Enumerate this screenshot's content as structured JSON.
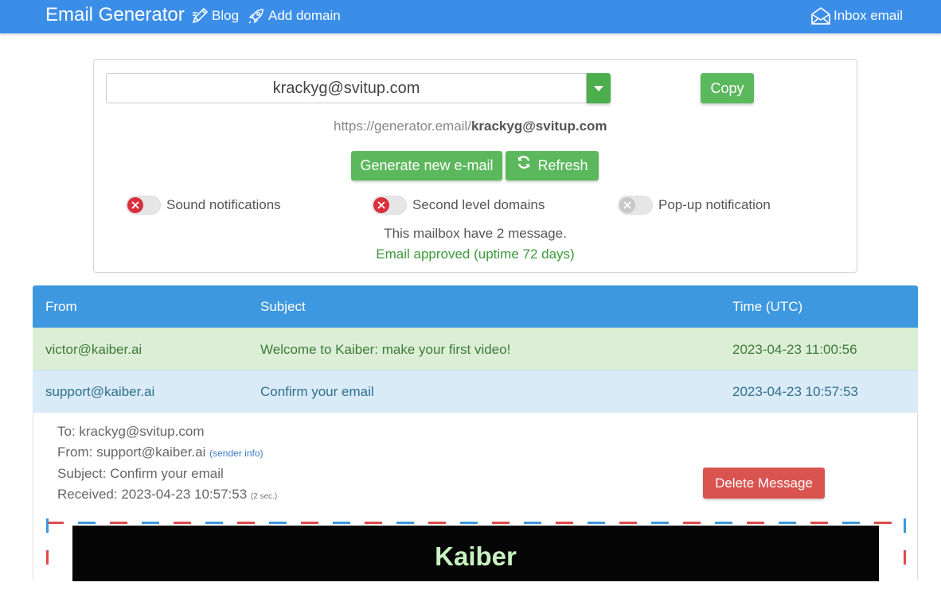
{
  "nav": {
    "brand": "Email Generator",
    "blog": "Blog",
    "add_domain": "Add domain",
    "inbox": "Inbox email"
  },
  "generator": {
    "email": "krackyg@svitup.com",
    "copy_label": "Copy",
    "url_prefix": "https://generator.email/",
    "url_email": "krackyg@svitup.com",
    "generate_label": "Generate new e-mail",
    "refresh_label": "Refresh",
    "toggles": [
      {
        "label": "Sound notifications",
        "state": "off"
      },
      {
        "label": "Second level domains",
        "state": "off"
      },
      {
        "label": "Pop-up notification",
        "state": "disabled"
      }
    ],
    "mailbox_message": "This mailbox have 2 message.",
    "approved_message": "Email approved (uptime 72 days)"
  },
  "table": {
    "headers": {
      "from": "From",
      "subject": "Subject",
      "time": "Time (UTC)"
    },
    "rows": [
      {
        "from": "victor@kaiber.ai",
        "subject": "Welcome to Kaiber: make your first video!",
        "time": "2023-04-23 11:00:56"
      },
      {
        "from": "support@kaiber.ai",
        "subject": "Confirm your email",
        "time": "2023-04-23 10:57:53"
      }
    ]
  },
  "message": {
    "to": "To: krackyg@svitup.com",
    "from": "From: support@kaiber.ai",
    "sender_info": "(sender info)",
    "subject": "Subject: Confirm your email",
    "received": "Received: 2023-04-23 10:57:53",
    "received_note": "(2 sec.)",
    "delete_label": "Delete Message",
    "banner_logo": "Kaiber"
  },
  "colors": {
    "nav": "#3b8ee8",
    "success": "#5cb85c",
    "danger": "#d9534f",
    "table_header": "#3e98df"
  }
}
